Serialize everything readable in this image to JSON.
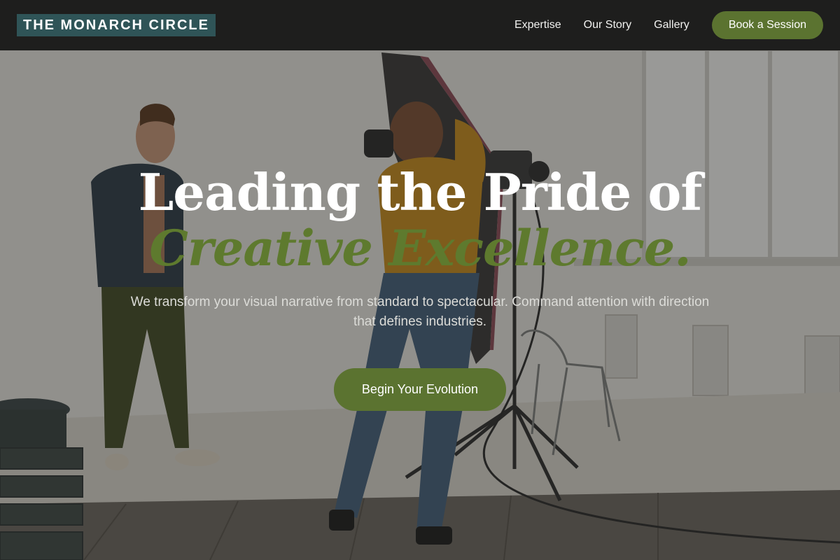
{
  "brand": {
    "name": "THE MONARCH CIRCLE"
  },
  "nav": {
    "links": [
      "Expertise",
      "Our Story",
      "Gallery"
    ],
    "cta_label": "Book a Session"
  },
  "hero": {
    "headline_line1": "Leading the Pride of",
    "headline_line2": "Creative Excellence.",
    "subtitle": "We transform your visual narrative from standard to spectacular. Command attention with direction that defines industries.",
    "cta_label": "Begin Your Evolution",
    "background_image": "photo-studio-shoot"
  },
  "colors": {
    "accent_green": "#5b7330",
    "logo_teal": "#2f5457",
    "nav_background": "#1e1e1d"
  }
}
